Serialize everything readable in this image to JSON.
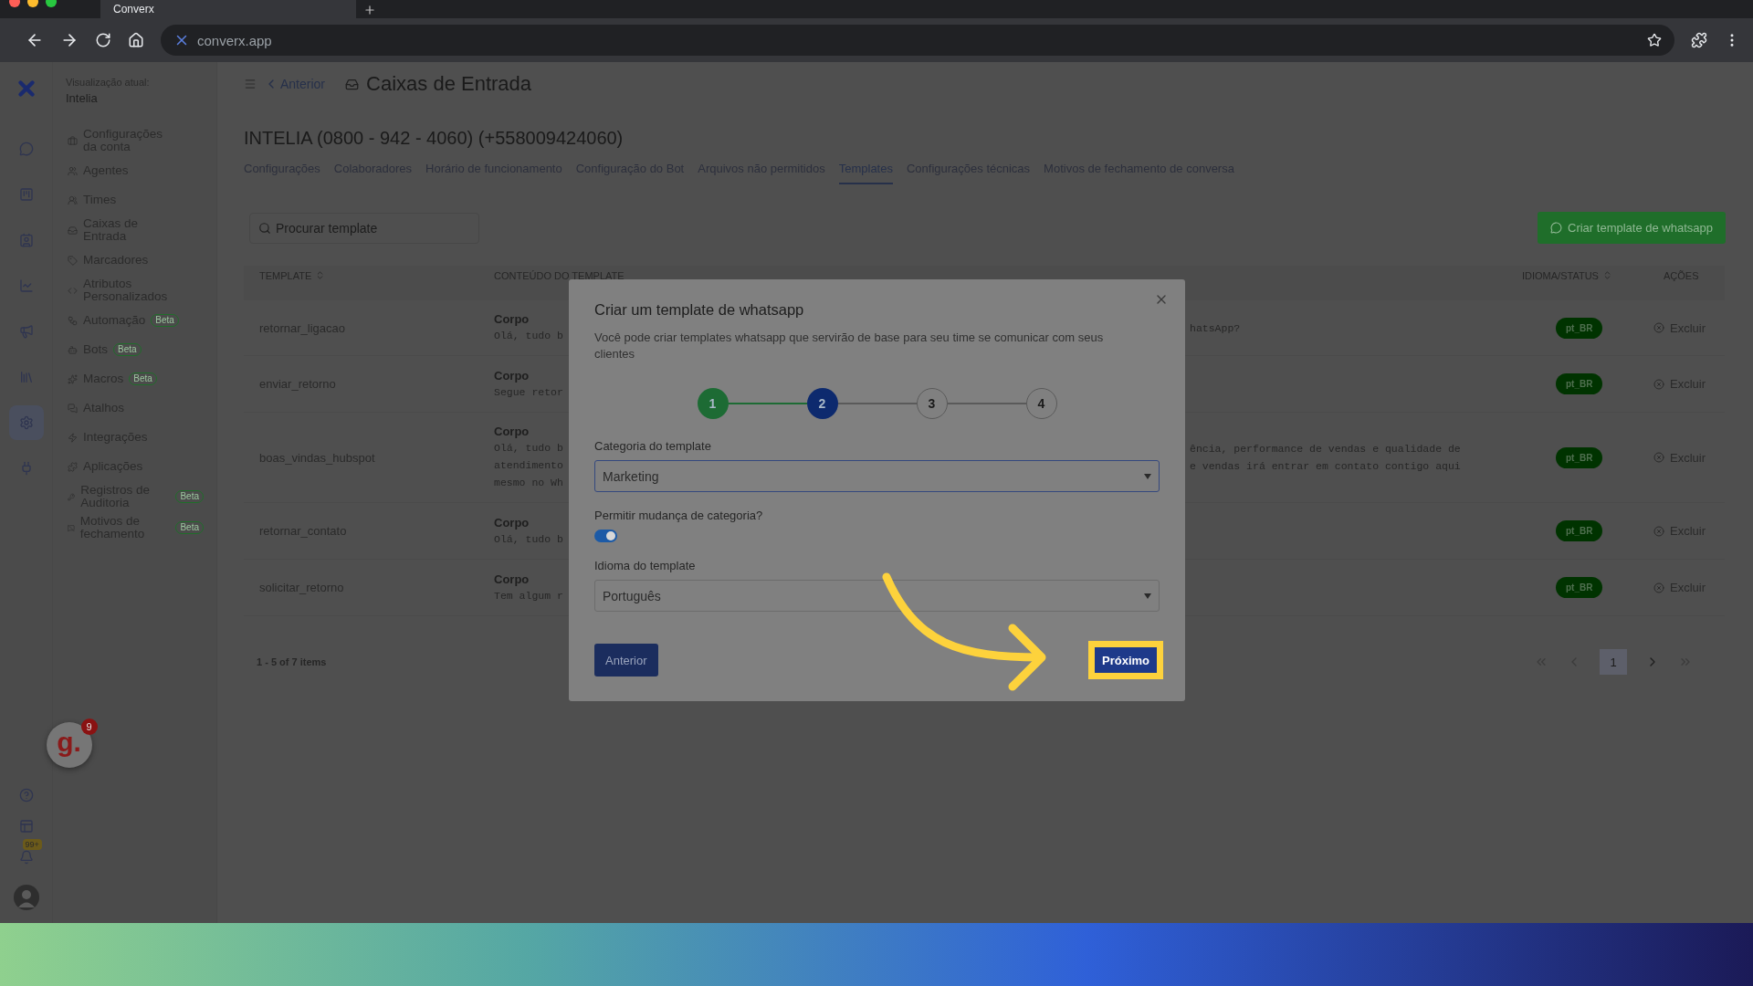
{
  "browser": {
    "tab_title": "Converx",
    "url": "converx.app"
  },
  "rail": {
    "items": [
      {
        "selected": false
      },
      {
        "selected": false
      },
      {
        "selected": false
      },
      {
        "selected": false
      },
      {
        "selected": false
      },
      {
        "selected": false
      },
      {
        "selected": true
      },
      {
        "selected": false
      }
    ],
    "notification_count": "99+"
  },
  "workspace": {
    "label": "Visualização atual:",
    "name": "Intelia"
  },
  "sidebar": {
    "items": [
      {
        "label": "Configurações da conta"
      },
      {
        "label": "Agentes"
      },
      {
        "label": "Times"
      },
      {
        "label": "Caixas de Entrada"
      },
      {
        "label": "Marcadores"
      },
      {
        "label": "Atributos Personalizados"
      },
      {
        "label": "Automação",
        "badge": "Beta"
      },
      {
        "label": "Bots",
        "badge": "Beta"
      },
      {
        "label": "Macros",
        "badge": "Beta"
      },
      {
        "label": "Atalhos"
      },
      {
        "label": "Integrações"
      },
      {
        "label": "Aplicações"
      },
      {
        "label": "Registros de Auditoria",
        "badge": "Beta"
      },
      {
        "label": "Motivos de fechamento",
        "badge": "Beta"
      }
    ]
  },
  "header": {
    "back": "Anterior",
    "title": "Caixas de Entrada"
  },
  "inbox_title": "INTELIA (0800 - 942 - 4060) (+558009424060)",
  "tabs": [
    {
      "label": "Configurações",
      "selected": false
    },
    {
      "label": "Colaboradores",
      "selected": false
    },
    {
      "label": "Horário de funcionamento",
      "selected": false
    },
    {
      "label": "Configuração do Bot",
      "selected": false
    },
    {
      "label": "Arquivos não permitidos",
      "selected": false
    },
    {
      "label": "Templates",
      "selected": true
    },
    {
      "label": "Configurações técnicas",
      "selected": false
    },
    {
      "label": "Motivos de fechamento de conversa",
      "selected": false
    }
  ],
  "search": {
    "placeholder": "Procurar template"
  },
  "create_button": "Criar template de whatsapp",
  "table": {
    "columns": [
      "TEMPLATE",
      "CONTEÚDO DO TEMPLATE",
      "IDIOMA/STATUS",
      "AÇÕES"
    ],
    "rows": [
      {
        "name": "retornar_ligacao",
        "heading": "Corpo",
        "content_left": [
          "Olá, tudo b"
        ],
        "content_right": [
          "hatsApp?"
        ],
        "language": "pt_BR",
        "action": "Excluir"
      },
      {
        "name": "enviar_retorno",
        "heading": "Corpo",
        "content_left": [
          "Segue retor"
        ],
        "content_right": [],
        "language": "pt_BR",
        "action": "Excluir"
      },
      {
        "name": "boas_vindas_hubspot",
        "heading": "Corpo",
        "content_left": [
          "Olá, tudo b",
          "atendimento",
          "mesmo no Wh"
        ],
        "content_right": [
          "ência, performance de vendas e qualidade de",
          "e vendas irá entrar em contato contigo aqui"
        ],
        "language": "pt_BR",
        "action": "Excluir"
      },
      {
        "name": "retornar_contato",
        "heading": "Corpo",
        "content_left": [
          "Olá, tudo b"
        ],
        "content_right": [],
        "language": "pt_BR",
        "action": "Excluir"
      },
      {
        "name": "solicitar_retorno",
        "heading": "Corpo",
        "content_left": [
          "Tem algum r"
        ],
        "content_right": [],
        "language": "pt_BR",
        "action": "Excluir"
      }
    ]
  },
  "footer": {
    "count": "1 - 5 of 7 items",
    "pages": [
      {
        "label": "1",
        "selected": true
      }
    ]
  },
  "modal": {
    "title": "Criar um template de whatsapp",
    "description": "Você pode criar templates whatsapp que servirão de base para seu time se comunicar com seus clientes",
    "steps": [
      {
        "label": "1",
        "kind": "done"
      },
      {
        "label": "2",
        "kind": "current"
      },
      {
        "label": "3",
        "kind": "pending"
      },
      {
        "label": "4",
        "kind": "pending"
      }
    ],
    "category_label": "Categoria do template",
    "category_value": "Marketing",
    "allow_change_label": "Permitir mudança de categoria?",
    "allow_change_on": true,
    "language_label": "Idioma do template",
    "language_value": "Português",
    "back_button": "Anterior",
    "next_button": "Próximo",
    "next_highlighted": true
  },
  "widget": {
    "logo": "g.",
    "count": "9"
  }
}
